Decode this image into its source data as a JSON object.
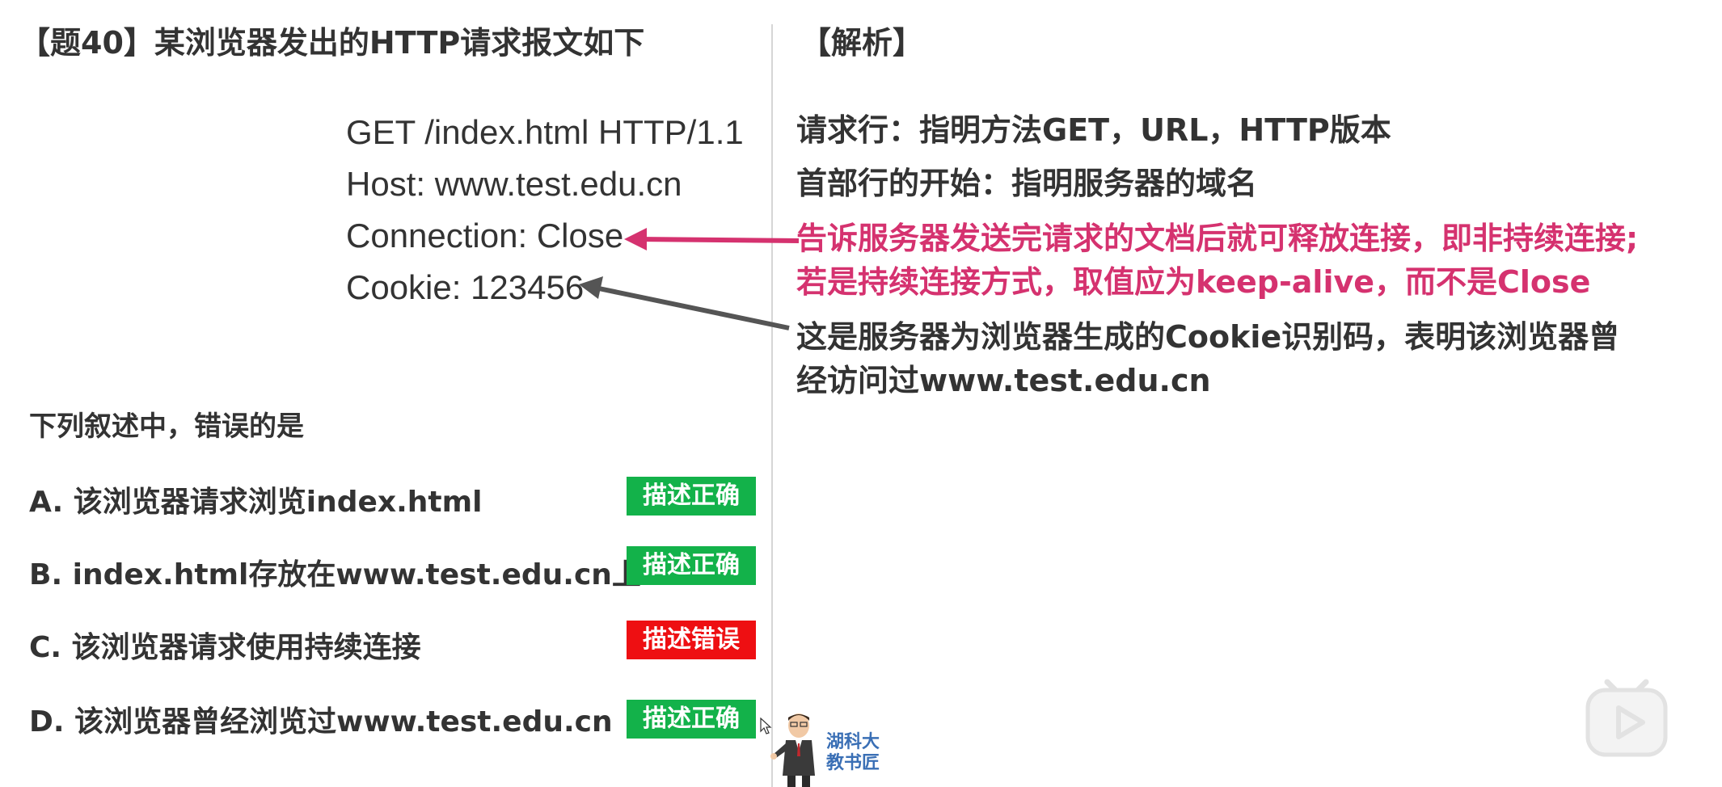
{
  "question": {
    "title": "【题40】某浏览器发出的HTTP请求报文如下",
    "request_lines": [
      "GET /index.html HTTP/1.1",
      "Host: www.test.edu.cn",
      "Connection: Close",
      "Cookie: 123456"
    ],
    "prompt": "下列叙述中，错误的是",
    "options": [
      {
        "text": "A. 该浏览器请求浏览index.html",
        "verdict": "描述正确",
        "status": "correct"
      },
      {
        "text": "B. index.html存放在www.test.edu.cn上",
        "verdict": "描述正确",
        "status": "correct"
      },
      {
        "text": "C. 该浏览器请求使用持续连接",
        "verdict": "描述错误",
        "status": "wrong"
      },
      {
        "text": "D. 该浏览器曾经浏览过www.test.edu.cn",
        "verdict": "描述正确",
        "status": "correct"
      }
    ]
  },
  "analysis": {
    "title": "【解析】",
    "request_line_note": "请求行：指明方法GET，URL，HTTP版本",
    "header_start_note": "首部行的开始：指明服务器的域名",
    "connection_note_1": "告诉服务器发送完请求的文档后就可释放连接，即非持续连接;",
    "connection_note_2": "若是持续连接方式，取值应为keep-alive，而不是Close",
    "cookie_note_1": "这是服务器为浏览器生成的Cookie识别码，表明该浏览器曾",
    "cookie_note_2": "经访问过www.test.edu.cn"
  },
  "mascot": {
    "line1": "湖科大",
    "line2": "教书匠"
  },
  "colors": {
    "correct": "#13b24a",
    "wrong": "#ee0f12",
    "highlight": "#d5326f",
    "arrow_dark": "#555555",
    "text": "#333333"
  },
  "icons": {
    "play": "play-icon",
    "cursor": "mouse-cursor-icon",
    "mascot": "teacher-avatar"
  }
}
